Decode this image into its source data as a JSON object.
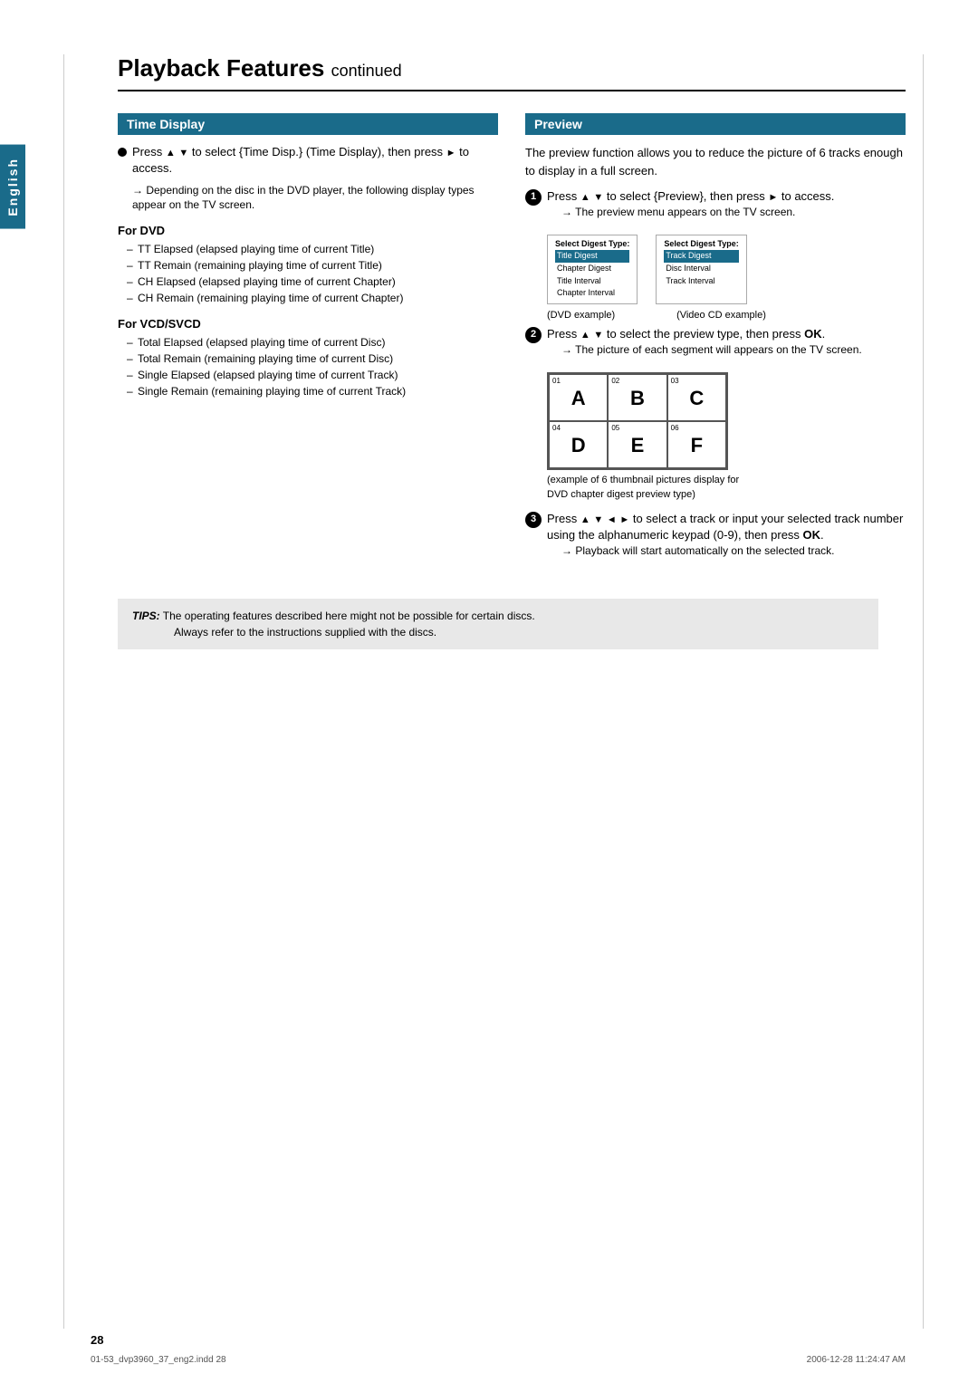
{
  "page": {
    "title": "Playback Features",
    "title_suffix": "continued",
    "page_number": "28",
    "footer_left": "01-53_dvp3960_37_eng2.indd  28",
    "footer_right": "2006-12-28  11:24:47 AM"
  },
  "english_tab": {
    "label": "English"
  },
  "time_display": {
    "header": "Time Display",
    "step1": "Press ▲ ▼ to select {Time Disp.} (Time Display), then press ► to access.",
    "arrow1": "Depending on the disc in the DVD player, the following display types appear on the TV screen.",
    "for_dvd_label": "For DVD",
    "dvd_items": [
      "TT Elapsed (elapsed playing time of current Title)",
      "TT Remain (remaining playing time of current Title)",
      "CH Elapsed (elapsed playing time of current Chapter)",
      "CH Remain (remaining playing time of current Chapter)"
    ],
    "for_vcd_label": "For VCD/SVCD",
    "vcd_items": [
      "Total Elapsed (elapsed playing time of current Disc)",
      "Total Remain (remaining playing time of current Disc)",
      "Single Elapsed (elapsed playing time of current Track)",
      "Single Remain (remaining playing time of current Track)"
    ]
  },
  "preview": {
    "header": "Preview",
    "intro": "The preview function allows you to reduce the picture of 6 tracks enough to display in a full screen.",
    "step1_text": "Press ▲ ▼ to select {Preview}, then press ► to access.",
    "step1_arrow": "The preview menu appears on the TV screen.",
    "dvd_table": {
      "header": "Select Digest Type:",
      "rows": [
        {
          "label": "Title Digest",
          "selected": true
        },
        {
          "label": "Chapter Digest",
          "selected": false
        },
        {
          "label": "Title Interval",
          "selected": false
        },
        {
          "label": "Chapter Interval",
          "selected": false
        }
      ]
    },
    "vcd_table": {
      "header": "Select Digest Type:",
      "rows": [
        {
          "label": "Track Digest",
          "selected": true
        },
        {
          "label": "Disc Interval",
          "selected": false
        },
        {
          "label": "Track Interval",
          "selected": false
        }
      ]
    },
    "dvd_caption": "(DVD example)",
    "vcd_caption": "(Video CD example)",
    "step2_text": "Press ▲ ▼ to select the preview type, then press OK.",
    "step2_arrow": "The picture of each segment will appears on the TV screen.",
    "thumb_cells": [
      {
        "num": "01",
        "letter": "A"
      },
      {
        "num": "02",
        "letter": "B"
      },
      {
        "num": "03",
        "letter": "C"
      },
      {
        "num": "04",
        "letter": "D"
      },
      {
        "num": "05",
        "letter": "E"
      },
      {
        "num": "06",
        "letter": "F"
      }
    ],
    "thumb_caption_line1": "(example of 6 thumbnail pictures display for",
    "thumb_caption_line2": "DVD chapter digest preview type)",
    "step3_text": "Press ▲ ▼ ◄ ► to select a track or input your selected track number using the alphanumeric keypad (0-9), then press OK.",
    "step3_arrow": "Playback will start automatically on the selected track."
  },
  "tips": {
    "label": "TIPS:",
    "line1": "The operating features described here might not be possible for certain discs.",
    "line2": "Always refer to the instructions supplied with the discs."
  }
}
